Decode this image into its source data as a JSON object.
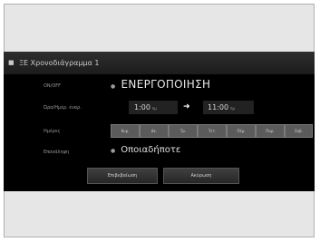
{
  "window": {
    "title": "ΞΕ Χρονοδιάγραμμα 1"
  },
  "rows": {
    "onoff": {
      "label": "ON/OFF",
      "value": "ΕΝΕΡΓΟΠΟΙΗΣΗ"
    },
    "start_end": {
      "label": "Ώρα/Ημέρ. έναρ.",
      "start_time": "1:00",
      "start_unit": "πμ",
      "end_time": "11:00",
      "end_unit": "πμ"
    },
    "days": {
      "label": "Ημέρες",
      "items": [
        "Κυρ.",
        "Δε.",
        "Τρ.",
        "Τετ.",
        "Πέμ.",
        "Παρ.",
        "Σαβ."
      ]
    },
    "repeat": {
      "label": "Επανάληψη",
      "value": "Οποιαδήποτε"
    }
  },
  "buttons": {
    "confirm": "Επιβεβαίωση",
    "cancel": "Ακύρωση"
  },
  "colors": {
    "screen_bg": "#000000",
    "frame_bg": "#e6e6e6",
    "day_button_bg": "#5b5b5b"
  },
  "icons": {
    "title_icon": "schedule-icon",
    "arrow": "right-arrow-icon"
  }
}
